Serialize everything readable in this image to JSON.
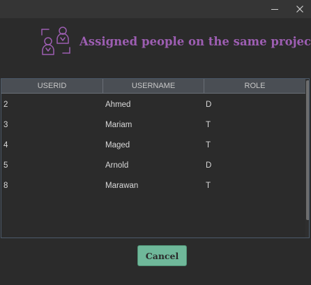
{
  "window": {
    "minimize_icon": "minimize-icon",
    "close_icon": "close-icon"
  },
  "header": {
    "icon": "people-exchange-icon",
    "title": "Assigned people on the same project:",
    "title_color": "#9d5eb2"
  },
  "table": {
    "columns": [
      "USERID",
      "USERNAME",
      "ROLE"
    ],
    "rows": [
      {
        "userid": "2",
        "username": "Ahmed",
        "role": "D"
      },
      {
        "userid": "3",
        "username": "Mariam",
        "role": "T"
      },
      {
        "userid": "4",
        "username": "Maged",
        "role": "T"
      },
      {
        "userid": "5",
        "username": "Arnold",
        "role": "D"
      },
      {
        "userid": "8",
        "username": "Marawan",
        "role": "T"
      }
    ]
  },
  "actions": {
    "cancel_label": "Cancel",
    "cancel_color": "#6fb89a"
  }
}
